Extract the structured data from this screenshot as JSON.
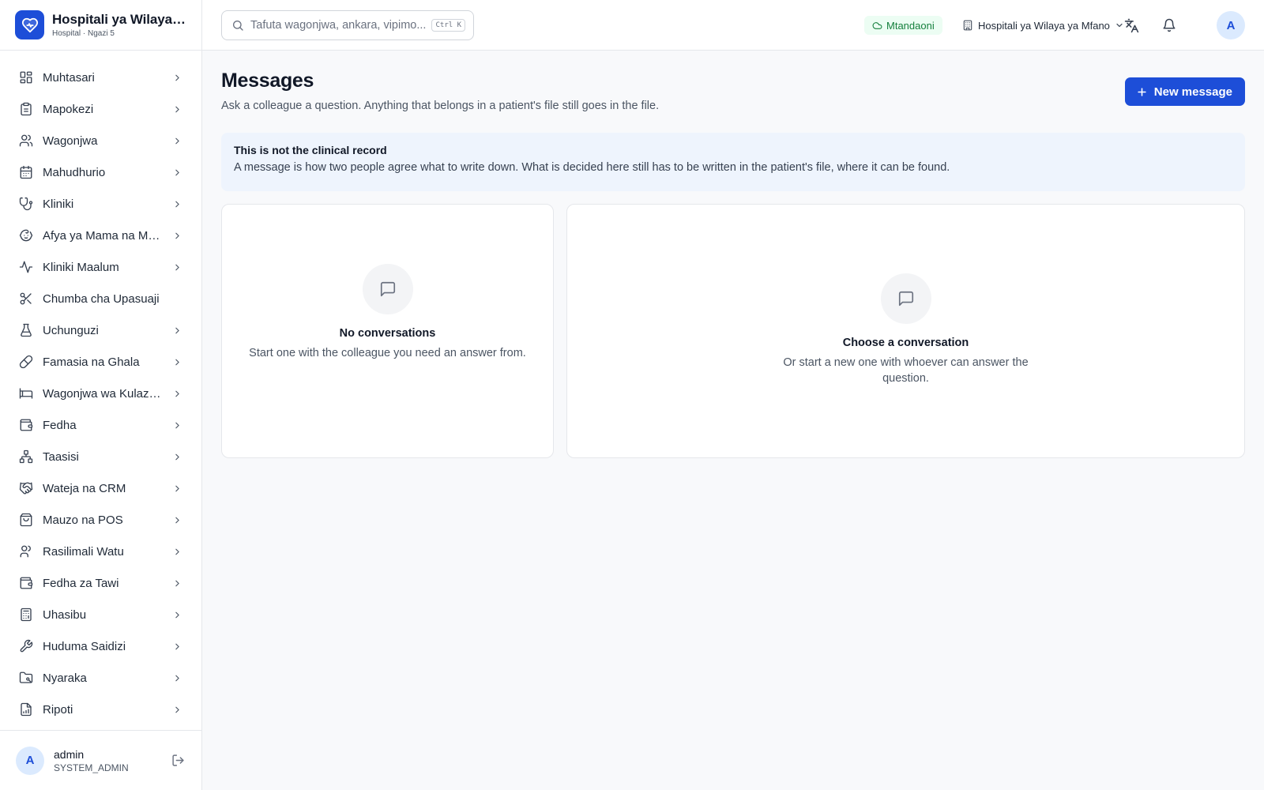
{
  "brand": {
    "name": "Hospitali ya Wilaya ya Mfano",
    "subtitle": "Hospital · Ngazi 5"
  },
  "sidebar": {
    "items": [
      {
        "label": "Muhtasari",
        "icon": "dashboard-icon",
        "has_children": true
      },
      {
        "label": "Mapokezi",
        "icon": "clipboard-icon",
        "has_children": true
      },
      {
        "label": "Wagonjwa",
        "icon": "users-icon",
        "has_children": true
      },
      {
        "label": "Mahudhurio",
        "icon": "calendar-icon",
        "has_children": true
      },
      {
        "label": "Kliniki",
        "icon": "stethoscope-icon",
        "has_children": true
      },
      {
        "label": "Afya ya Mama na Mtoto",
        "icon": "baby-icon",
        "has_children": true
      },
      {
        "label": "Kliniki Maalum",
        "icon": "activity-icon",
        "has_children": true
      },
      {
        "label": "Chumba cha Upasuaji",
        "icon": "scissors-icon",
        "has_children": false
      },
      {
        "label": "Uchunguzi",
        "icon": "flask-icon",
        "has_children": true
      },
      {
        "label": "Famasia na Ghala",
        "icon": "pill-icon",
        "has_children": true
      },
      {
        "label": "Wagonjwa wa Kulazwa",
        "icon": "bed-icon",
        "has_children": true
      },
      {
        "label": "Fedha",
        "icon": "wallet-icon",
        "has_children": true
      },
      {
        "label": "Taasisi",
        "icon": "network-icon",
        "has_children": true
      },
      {
        "label": "Wateja na CRM",
        "icon": "handshake-icon",
        "has_children": true
      },
      {
        "label": "Mauzo na POS",
        "icon": "shopping-bag-icon",
        "has_children": true
      },
      {
        "label": "Rasilimali Watu",
        "icon": "user-icon",
        "has_children": true
      },
      {
        "label": "Fedha za Tawi",
        "icon": "wallet-icon",
        "has_children": true
      },
      {
        "label": "Uhasibu",
        "icon": "calculator-icon",
        "has_children": true
      },
      {
        "label": "Huduma Saidizi",
        "icon": "wrench-icon",
        "has_children": true
      },
      {
        "label": "Nyaraka",
        "icon": "folder-icon",
        "has_children": true
      },
      {
        "label": "Ripoti",
        "icon": "report-icon",
        "has_children": true
      }
    ]
  },
  "user": {
    "initial": "A",
    "name": "admin",
    "role": "SYSTEM_ADMIN"
  },
  "topbar": {
    "search_placeholder": "Tafuta wagonjwa, ankara, vipimo...",
    "search_value": "",
    "shortcut": "Ctrl K",
    "status": "Mtandaoni",
    "status_color": "#15803d",
    "facility": "Hospitali ya Wilaya ya Mfano",
    "avatar_initial": "A"
  },
  "page": {
    "title": "Messages",
    "subtitle": "Ask a colleague a question. Anything that belongs in a patient's file still goes in the file.",
    "new_button": "New message",
    "accent": "#1d4ed8"
  },
  "notice": {
    "title": "This is not the clinical record",
    "text": "A message is how two people agree what to write down. What is decided here still has to be written in the patient's file, where it can be found."
  },
  "conversations": {
    "empty_title": "No conversations",
    "empty_text": "Start one with the colleague you need an answer from."
  },
  "detail": {
    "empty_title": "Choose a conversation",
    "empty_text": "Or start a new one with whoever can answer the question."
  }
}
